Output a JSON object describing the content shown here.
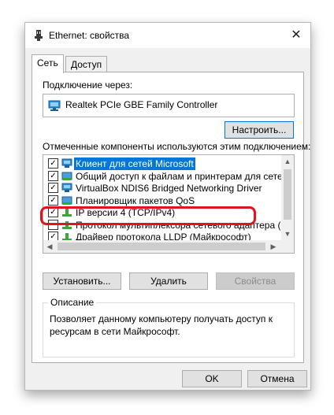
{
  "window": {
    "title": "Ethernet: свойства",
    "close_glyph": "✕"
  },
  "tabs": [
    {
      "label": "Сеть",
      "active": true
    },
    {
      "label": "Доступ",
      "active": false
    }
  ],
  "connection": {
    "label": "Подключение через:",
    "adapter": "Realtek PCIe GBE Family Controller",
    "configure_button": "Настроить..."
  },
  "components": {
    "label": "Отмеченные компоненты используются этим подключением:",
    "items": [
      {
        "label": "Клиент для сетей Microsoft",
        "checked": true,
        "icon": "network-client-icon",
        "selected": true
      },
      {
        "label": "Общий доступ к файлам и принтерам для сетей Mi",
        "checked": true,
        "icon": "service-icon",
        "selected": false
      },
      {
        "label": "VirtualBox NDIS6 Bridged Networking Driver",
        "checked": true,
        "icon": "network-client-icon",
        "selected": false
      },
      {
        "label": "Планировщик пакетов QoS",
        "checked": true,
        "icon": "service-icon",
        "selected": false
      },
      {
        "label": "IP версии 4 (TCP/IPv4)",
        "checked": true,
        "icon": "protocol-icon",
        "selected": false
      },
      {
        "label": "Протокол мультиплексора сетевого адаптера (Майк",
        "checked": false,
        "icon": "protocol-icon",
        "selected": false
      },
      {
        "label": "Драйвер протокола LLDP (Майкрософт)",
        "checked": true,
        "icon": "protocol-icon",
        "selected": false
      }
    ]
  },
  "component_buttons": {
    "install": "Установить...",
    "remove": "Удалить",
    "properties": "Свойства"
  },
  "description": {
    "legend": "Описание",
    "text": "Позволяет данному компьютеру получать доступ к ресурсам в сети Майкрософт."
  },
  "footer": {
    "ok": "OK",
    "cancel": "Отмена"
  },
  "colors": {
    "selection": "#0078d7",
    "highlight_outline": "#e0141b",
    "dialog_bg": "#f0f0f0"
  }
}
